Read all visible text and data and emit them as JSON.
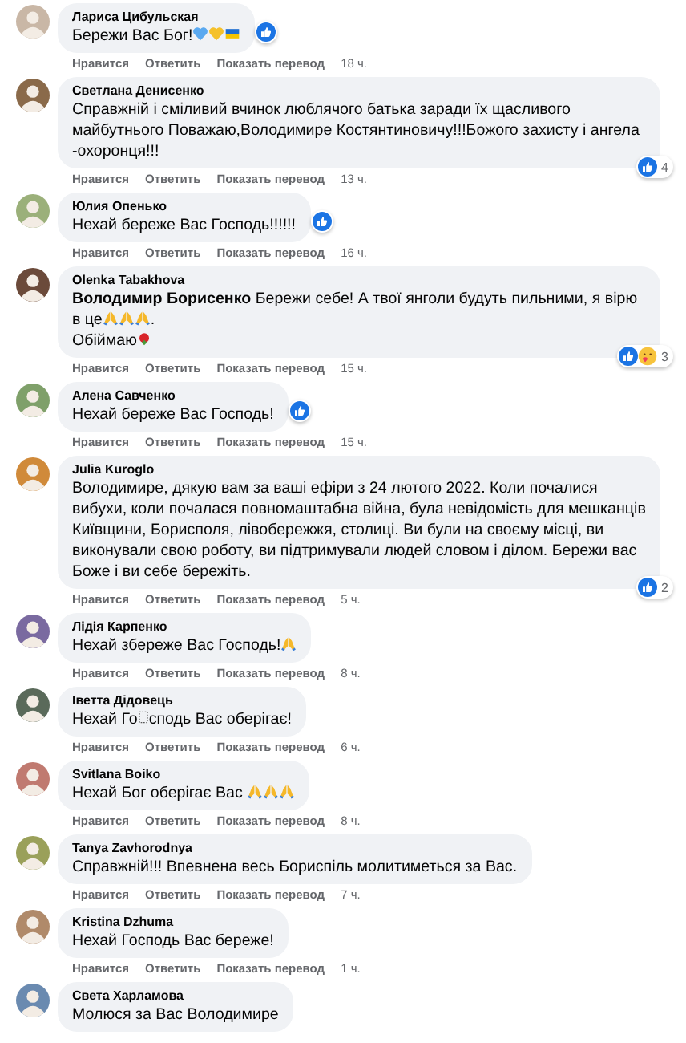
{
  "comments": [
    {
      "author": "Лариса Цибульская",
      "body": [
        {
          "kind": "text",
          "text": "Бережи Вас Бог!"
        },
        {
          "kind": "blue-heart"
        },
        {
          "kind": "yellow-heart"
        },
        {
          "kind": "flag"
        }
      ],
      "actions": [
        "Нравится",
        "Ответить",
        "Показать перевод"
      ],
      "time": "18 ч.",
      "reactions": {
        "icons": [
          {
            "kind": "like"
          }
        ]
      }
    },
    {
      "author": "Светлана Денисенко",
      "body": [
        {
          "kind": "text",
          "text": "Справжній і сміливий вчинок люблячого батька заради їх щасливого майбутнього Поважаю,Володимире Костянтиновичу!!!Божого захисту і ангела -охоронця!!!"
        }
      ],
      "actions": [
        "Нравится",
        "Ответить",
        "Показать перевод"
      ],
      "time": "13 ч.",
      "reactions": {
        "icons": [
          {
            "kind": "like"
          }
        ],
        "count": "4"
      }
    },
    {
      "author": "Юлия Опенько",
      "body": [
        {
          "kind": "text",
          "text": "Нехай береже Вас Господь!!!!!!"
        }
      ],
      "actions": [
        "Нравится",
        "Ответить",
        "Показать перевод"
      ],
      "time": "16 ч.",
      "reactions": {
        "icons": [
          {
            "kind": "like"
          }
        ]
      }
    },
    {
      "author": "Olenka Tabakhova",
      "body": [
        {
          "kind": "text",
          "text": "**Володимир Борисенко** Бережи себе! А твої янголи будуть пильними, я вірю в це"
        },
        {
          "kind": "pray"
        },
        {
          "kind": "pray"
        },
        {
          "kind": "pray"
        },
        {
          "kind": "text",
          "text": "."
        },
        {
          "kind": "break"
        },
        {
          "kind": "text",
          "text": "Обіймаю"
        },
        {
          "kind": "rose"
        }
      ],
      "actions": [
        "Нравится",
        "Ответить",
        "Показать перевод"
      ],
      "time": "15 ч.",
      "reactions": {
        "icons": [
          {
            "kind": "like"
          },
          {
            "kind": "care"
          }
        ],
        "count": "3"
      }
    },
    {
      "author": "Алена Савченко",
      "body": [
        {
          "kind": "text",
          "text": "Нехай береже Вас Господь!"
        }
      ],
      "actions": [
        "Нравится",
        "Ответить",
        "Показать перевод"
      ],
      "time": "15 ч.",
      "reactions": {
        "icons": [
          {
            "kind": "like"
          }
        ]
      }
    },
    {
      "author": "Julia Kuroglo",
      "body": [
        {
          "kind": "text",
          "text": "Володимире, дякую вам за ваші ефіри з 24 лютого 2022. Коли почалися вибухи, коли почалася повномаштабна війна, була невідомість для мешканців Київщини, Борисполя, лівобережжя, столиці. Ви були на своєму місці, ви виконували свою роботу, ви підтримували людей словом і ділом. Бережи вас Боже і ви себе бережіть."
        }
      ],
      "actions": [
        "Нравится",
        "Ответить",
        "Показать перевод"
      ],
      "time": "5 ч.",
      "reactions": {
        "icons": [
          {
            "kind": "like"
          }
        ],
        "count": "2"
      }
    },
    {
      "author": "Лідія Карпенко",
      "body": [
        {
          "kind": "text",
          "text": "Нехай збереже Вас Господь!"
        },
        {
          "kind": "pray"
        }
      ],
      "actions": [
        "Нравится",
        "Ответить",
        "Показать перевод"
      ],
      "time": "8 ч."
    },
    {
      "author": "Іветта Дідовець",
      "body": [
        {
          "kind": "text",
          "text": "Нехай Го"
        },
        {
          "kind": "missing"
        },
        {
          "kind": "text",
          "text": "сподь Вас оберігає!"
        }
      ],
      "actions": [
        "Нравится",
        "Ответить",
        "Показать перевод"
      ],
      "time": "6 ч."
    },
    {
      "author": "Svitlana Boiko",
      "body": [
        {
          "kind": "text",
          "text": "Нехай Бог оберігає Вас "
        },
        {
          "kind": "pray"
        },
        {
          "kind": "pray"
        },
        {
          "kind": "pray"
        }
      ],
      "actions": [
        "Нравится",
        "Ответить",
        "Показать перевод"
      ],
      "time": "8 ч."
    },
    {
      "author": "Tanya Zavhorodnya",
      "body": [
        {
          "kind": "text",
          "text": "Справжній!!! Впевнена весь Бориспіль молитиметься за Вас."
        }
      ],
      "actions": [
        "Нравится",
        "Ответить",
        "Показать перевод"
      ],
      "time": "7 ч."
    },
    {
      "author": "Kristina Dzhuma",
      "body": [
        {
          "kind": "text",
          "text": "Нехай Господь Вас береже!"
        }
      ],
      "actions": [
        "Нравится",
        "Ответить",
        "Показать перевод"
      ],
      "time": "1 ч."
    },
    {
      "author": "Света Харламова",
      "body": [
        {
          "kind": "text",
          "text": "Молюся за Вас Володимире"
        }
      ]
    }
  ]
}
